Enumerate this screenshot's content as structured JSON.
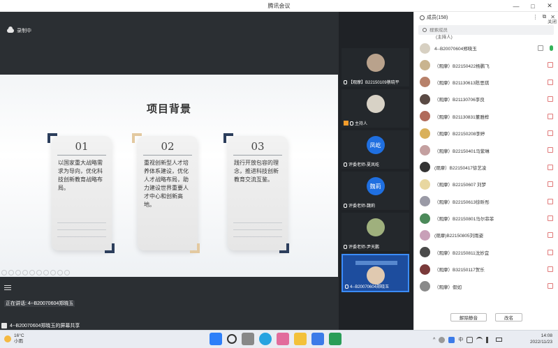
{
  "window": {
    "title": "腾讯会议",
    "controls": [
      "—",
      "□",
      "✕"
    ]
  },
  "recording": {
    "label": "录制中"
  },
  "slide": {
    "title": "项目背景",
    "cards": [
      {
        "num": "01",
        "text": "以国家重大战略需求为导向，优化科技创新教育战略布局。"
      },
      {
        "num": "02",
        "text": "重视创新型人才培养体系建设，优化人才战略布局，助力建设世界重要人才中心和创新高地。"
      },
      {
        "num": "03",
        "text": "践行开放包容的理念，推进科技创新教育交流互鉴。"
      }
    ]
  },
  "speaking": {
    "label": "正在讲话: 4--B20070604郑晓玉"
  },
  "share_bar": {
    "label": "4--B20070604郑晓玉的屏幕共享"
  },
  "videos": [
    {
      "name": "【观摩】B22150109蔡晓平",
      "avatar_color": "#b9a28c"
    },
    {
      "name": "主持人",
      "avatar_color": "#d8d2c6"
    },
    {
      "name": "评委老师-夏凤屹",
      "avatar_text": "凤屹",
      "avatar_color": "#1f6fe0"
    },
    {
      "name": "评委老师-魏莉",
      "avatar_text": "魏莉",
      "avatar_color": "#1f6fe0"
    },
    {
      "name": "评委老师-尹天鹏",
      "avatar_color": "#9fb07d"
    },
    {
      "name": "4--B20070604郑晓玉",
      "avatar_color": "#3a5fa8"
    }
  ],
  "members": {
    "header": "成员(158)",
    "close": "关闭",
    "search_placeholder": "搜索成员",
    "top_partial": "(主持人)",
    "list": [
      {
        "name": "4--B20070604郑晓玉",
        "color": "#d7d0c2",
        "mic": "on"
      },
      {
        "name": "（观摩）B22150422杨鹏飞",
        "color": "#c9b48f"
      },
      {
        "name": "（观摩）B21130613陈思琪",
        "color": "#b7816a"
      },
      {
        "name": "（观摩）B21130706李良",
        "color": "#5a4a44"
      },
      {
        "name": "（观摩）B21130831董雅桦",
        "color": "#b06a5a"
      },
      {
        "name": "（观摩）B22150208李婷",
        "color": "#d9b05a"
      },
      {
        "name": "（观摩）B22150401马紫琳",
        "color": "#c4a0a0"
      },
      {
        "name": "(观摩）B22150417徐艺凌",
        "color": "#333333"
      },
      {
        "name": "（观摩）B22150607 刘梦",
        "color": "#e8d7a0"
      },
      {
        "name": "（观摩）B22150613徐昕彤",
        "color": "#9a9aa6"
      },
      {
        "name": "（观摩）B22150801马尔菲菲",
        "color": "#4c8a5a"
      },
      {
        "name": "(观摩)B22150805刘雨姿",
        "color": "#c8a0b8"
      },
      {
        "name": "（观摩）B22150811沈妙宜",
        "color": "#4a4a4a"
      },
      {
        "name": "（观摩）B32150117贺乐",
        "color": "#7a3a3a"
      },
      {
        "name": "（观摩）假如",
        "color": "#8a8a8a"
      }
    ],
    "buttons": {
      "unmute": "解除静音",
      "rename": "改名"
    }
  },
  "taskbar": {
    "weather_temp": "16°C",
    "weather_desc": "小雨",
    "tray_lang": "中",
    "time": "14:08",
    "date": "2022/11/23"
  }
}
